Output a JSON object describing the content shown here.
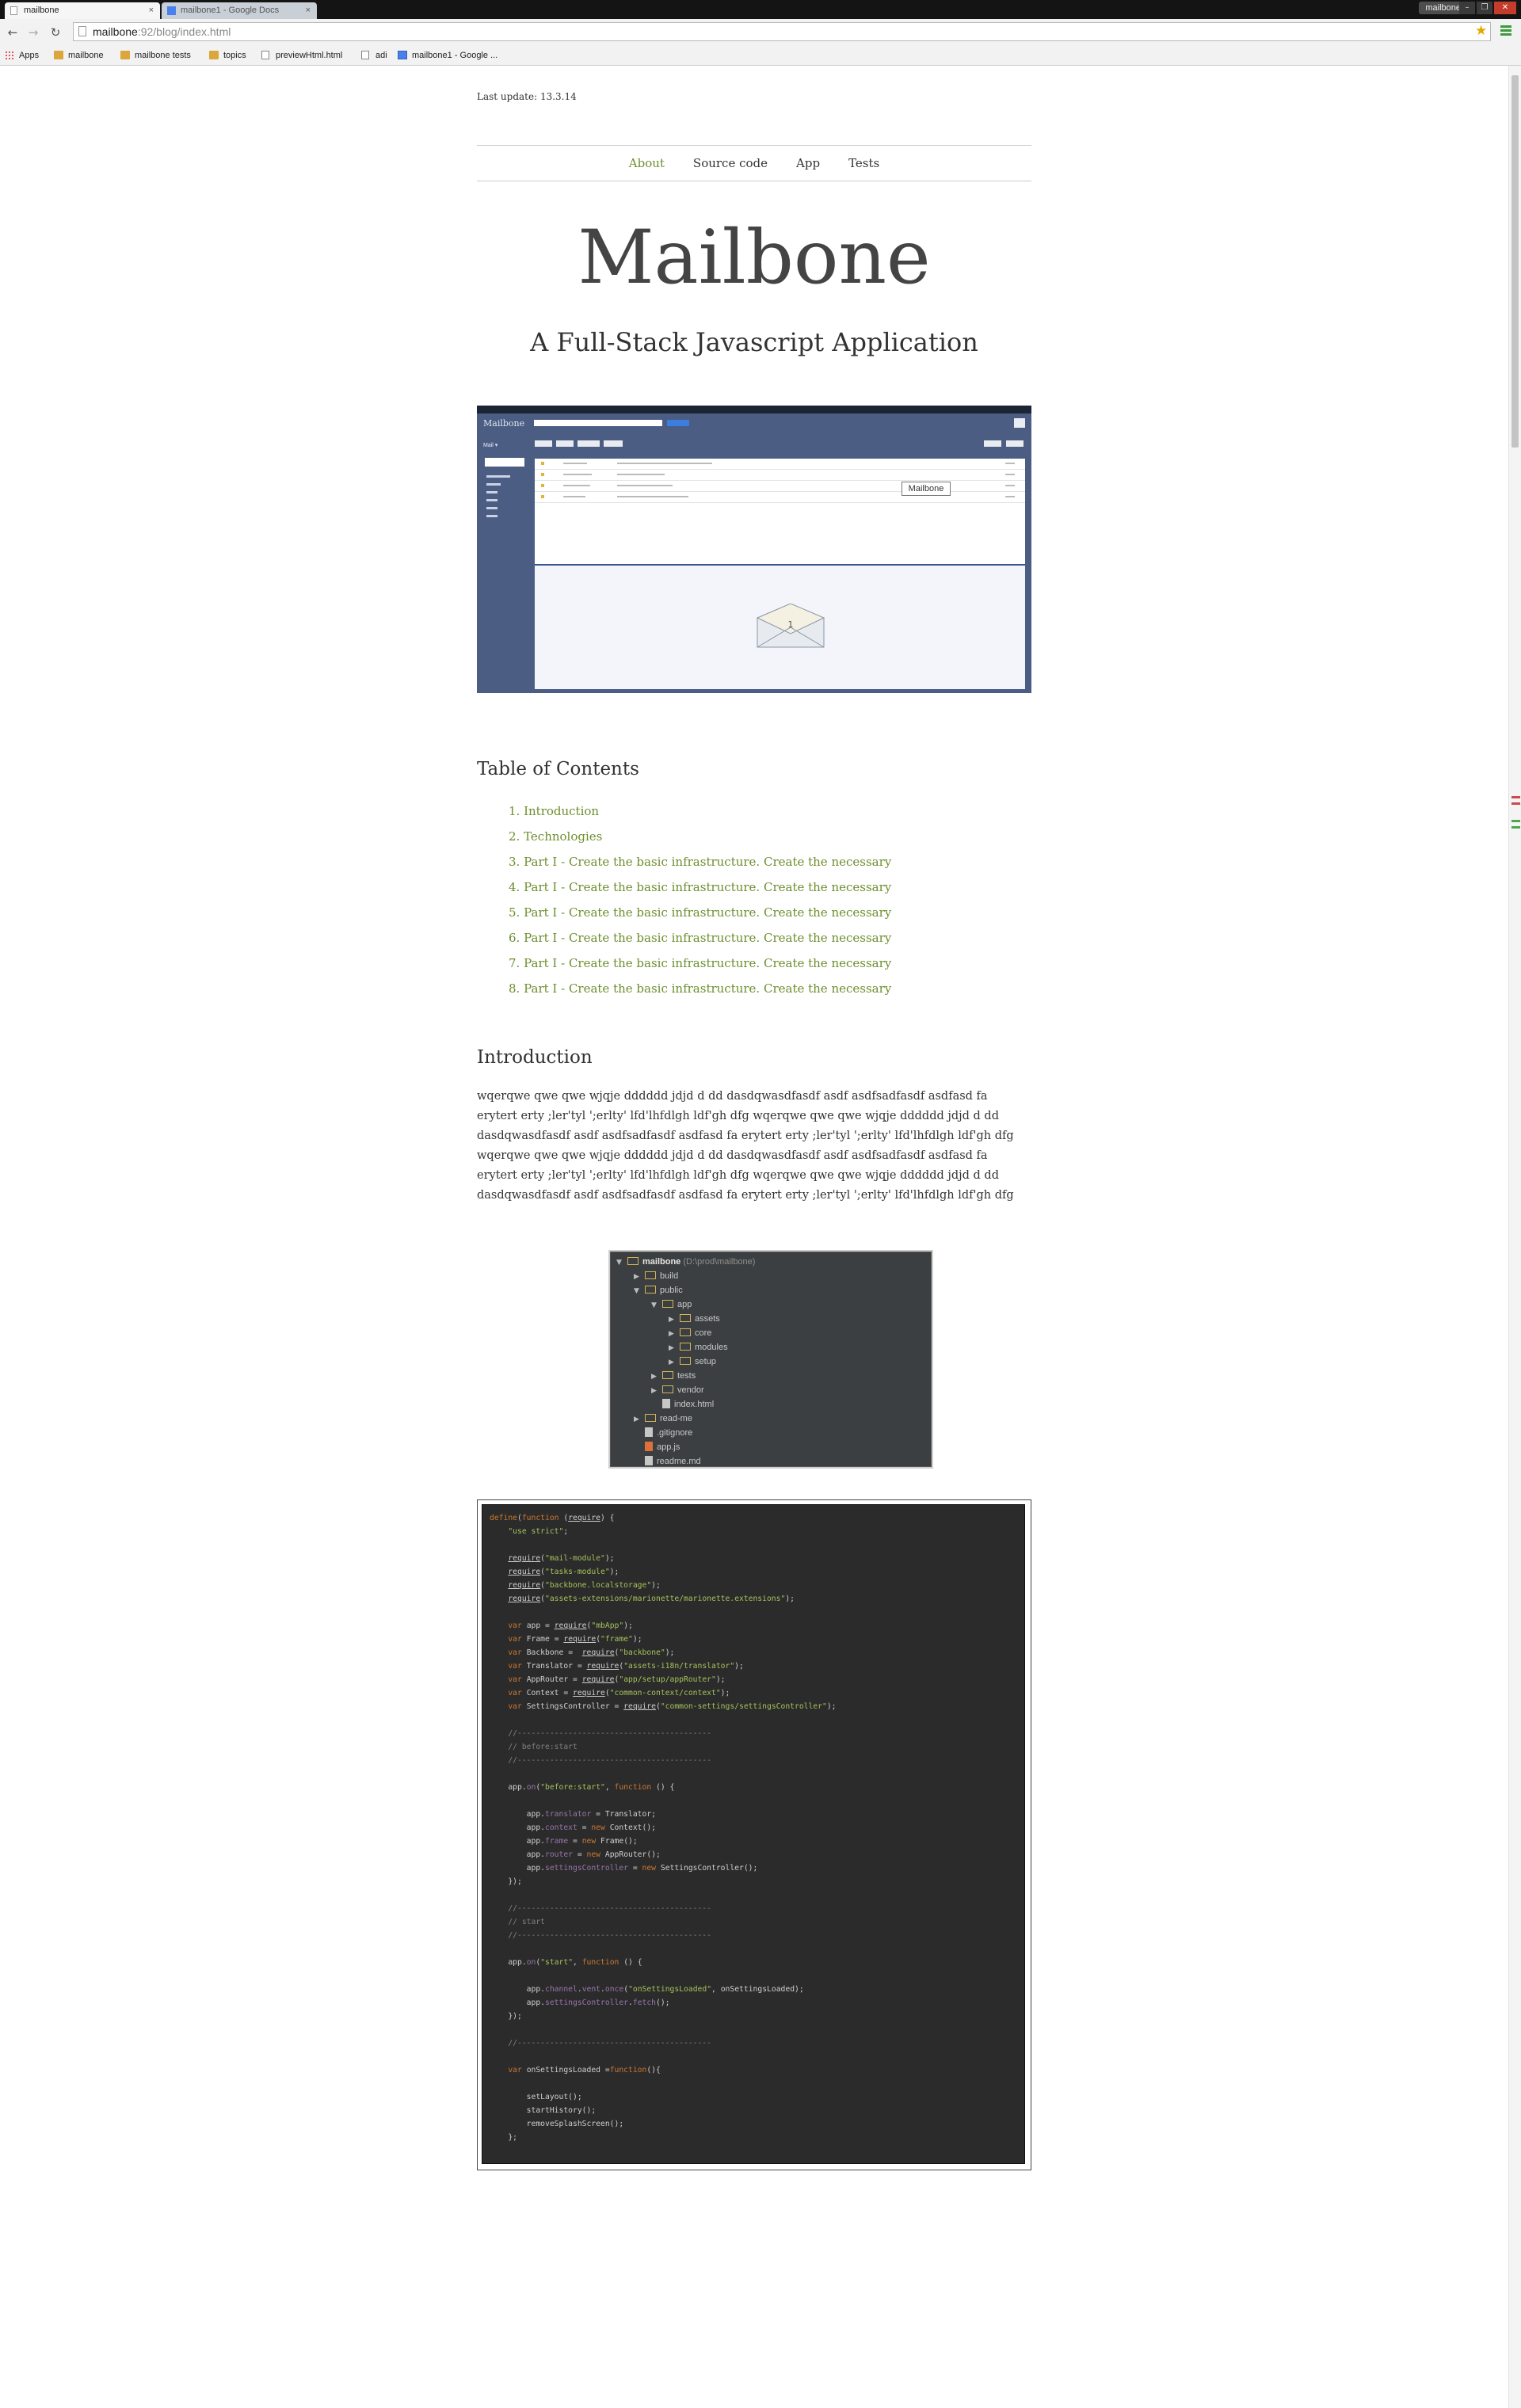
{
  "browser": {
    "tabs": [
      {
        "title": "mailbone",
        "active": true
      },
      {
        "title": "mailbone1 - Google Docs",
        "active": false
      }
    ],
    "close_glyph": "×",
    "profile": "mailbone",
    "window_buttons": [
      "–",
      "❐",
      "✕"
    ],
    "url_host": "mailbone",
    "url_path": ":92/blog/index.html",
    "nav": {
      "back": "←",
      "forward": "→",
      "reload": "↻"
    },
    "star_glyph": "★",
    "bookmarks": [
      {
        "label": "Apps",
        "icon": "apps-icon"
      },
      {
        "label": "mailbone",
        "icon": "folder-icon"
      },
      {
        "label": "mailbone tests",
        "icon": "folder-icon"
      },
      {
        "label": "topics",
        "icon": "folder-icon"
      },
      {
        "label": "previewHtml.html",
        "icon": "page-icon"
      },
      {
        "label": "adi",
        "icon": "page-icon"
      },
      {
        "label": "mailbone1 - Google ...",
        "icon": "docs-icon"
      }
    ],
    "accent": "#6d8e2d"
  },
  "page": {
    "last_update": "Last update: 13.3.14",
    "nav": [
      "About",
      "Source code",
      "App",
      "Tests"
    ],
    "title": "Mailbone",
    "subtitle": "A Full-Stack Javascript Application",
    "app_screenshot": {
      "brand": "Mailbone",
      "mail_label": "Mail ▾",
      "tooltip": "Mailbone",
      "envelope_count": "1"
    },
    "toc_title": "Table of Contents",
    "toc": [
      "1. Introduction",
      "2. Technologies",
      "3. Part I - Create the basic infrastructure. Create the necessary",
      "4. Part I - Create the basic infrastructure. Create the necessary",
      "5. Part I - Create the basic infrastructure. Create the necessary",
      "6. Part I - Create the basic infrastructure. Create the necessary",
      "7. Part I - Create the basic infrastructure. Create the necessary",
      "8. Part I - Create the basic infrastructure. Create the necessary"
    ],
    "intro_title": "Introduction",
    "intro_text": "wqerqwe qwe qwe wjqje dddddd jdjd d dd dasdqwasdfasdf asdf asdfsadfasdf asdfasd fa erytert erty ;ler'tyl ';erlty' lfd'lhfdlgh ldf'gh dfg wqerqwe qwe qwe wjqje dddddd jdjd d dd dasdqwasdfasdf asdf asdfsadfasdf asdfasd fa erytert erty ;ler'tyl ';erlty' lfd'lhfdlgh ldf'gh dfg wqerqwe qwe qwe wjqje dddddd jdjd d dd dasdqwasdfasdf asdf asdfsadfasdf asdfasd fa erytert erty ;ler'tyl ';erlty' lfd'lhfdlgh ldf'gh dfg wqerqwe qwe qwe wjqje dddddd jdjd d dd dasdqwasdfasdf asdf asdfsadfasdf asdfasd fa erytert erty ;ler'tyl ';erlty' lfd'lhfdlgh ldf'gh dfg"
  },
  "file_tree": [
    {
      "depth": 0,
      "arrow": "▼",
      "kind": "folder",
      "name": "mailbone",
      "extra": " (D:\\prod\\mailbone)"
    },
    {
      "depth": 1,
      "arrow": "▶",
      "kind": "folder",
      "name": "build"
    },
    {
      "depth": 1,
      "arrow": "▼",
      "kind": "folder",
      "name": "public"
    },
    {
      "depth": 2,
      "arrow": "▼",
      "kind": "folder",
      "name": "app"
    },
    {
      "depth": 3,
      "arrow": "▶",
      "kind": "folder",
      "name": "assets"
    },
    {
      "depth": 3,
      "arrow": "▶",
      "kind": "folder",
      "name": "core"
    },
    {
      "depth": 3,
      "arrow": "▶",
      "kind": "folder",
      "name": "modules"
    },
    {
      "depth": 3,
      "arrow": "▶",
      "kind": "folder",
      "name": "setup"
    },
    {
      "depth": 2,
      "arrow": "▶",
      "kind": "folder",
      "name": "tests"
    },
    {
      "depth": 2,
      "arrow": "▶",
      "kind": "folder",
      "name": "vendor"
    },
    {
      "depth": 2,
      "arrow": "",
      "kind": "file",
      "name": "index.html"
    },
    {
      "depth": 1,
      "arrow": "▶",
      "kind": "folder",
      "name": "read-me"
    },
    {
      "depth": 1,
      "arrow": "",
      "kind": "file",
      "name": ".gitignore"
    },
    {
      "depth": 1,
      "arrow": "",
      "kind": "js",
      "name": "app.js"
    },
    {
      "depth": 1,
      "arrow": "",
      "kind": "file",
      "name": "readme.md"
    }
  ],
  "code_colors": {
    "keyword": "#cc7832",
    "string": "#a5c25c",
    "comment": "#808080",
    "property": "#9876aa",
    "function": "#ffc66d",
    "plain": "#cfcfcf"
  },
  "code_lines": [
    "define(function (require) {",
    "    \"use strict\";",
    "",
    "    require(\"mail-module\");",
    "    require(\"tasks-module\");",
    "    require(\"backbone.localstorage\");",
    "    require(\"assets-extensions/marionette/marionette.extensions\");",
    "",
    "    var app = require(\"mbApp\");",
    "    var Frame = require(\"frame\");",
    "    var Backbone =  require(\"backbone\");",
    "    var Translator = require(\"assets-i18n/translator\");",
    "    var AppRouter = require(\"app/setup/appRouter\");",
    "    var Context = require(\"common-context/context\");",
    "    var SettingsController = require(\"common-settings/settingsController\");",
    "",
    "    //------------------------------------------",
    "    // before:start",
    "    //------------------------------------------",
    "",
    "    app.on(\"before:start\", function () {",
    "",
    "        app.translator = Translator;",
    "        app.context = new Context();",
    "        app.frame = new Frame();",
    "        app.router = new AppRouter();",
    "        app.settingsController = new SettingsController();",
    "    });",
    "",
    "    //------------------------------------------",
    "    // start",
    "    //------------------------------------------",
    "",
    "    app.on(\"start\", function () {",
    "",
    "        app.channel.vent.once(\"onSettingsLoaded\", onSettingsLoaded);",
    "        app.settingsController.fetch();",
    "    });",
    "",
    "    //------------------------------------------",
    "",
    "    var onSettingsLoaded =function(){",
    "",
    "        setLayout();",
    "        startHistory();",
    "        removeSplashScreen();",
    "    };"
  ]
}
